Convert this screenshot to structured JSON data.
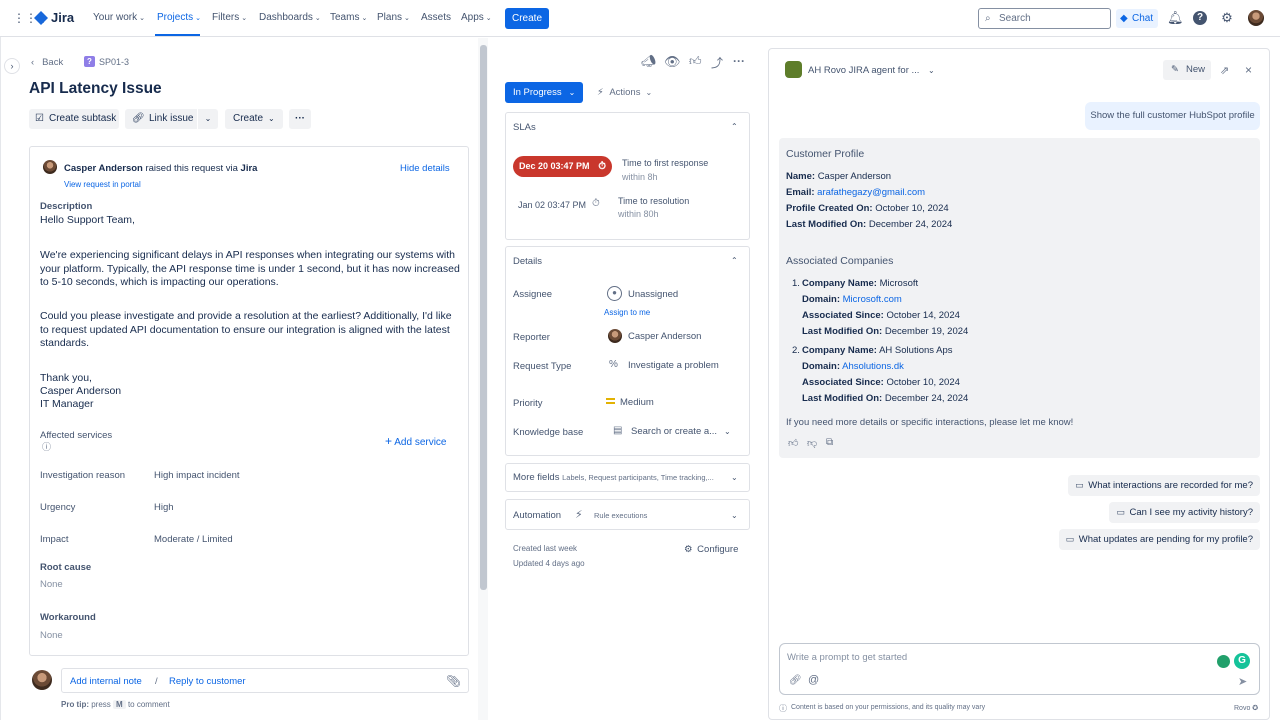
{
  "topnav": {
    "logo": "Jira",
    "items": [
      "Your work",
      "Projects",
      "Filters",
      "Dashboards",
      "Teams",
      "Plans",
      "Assets",
      "Apps"
    ],
    "create": "Create",
    "search_placeholder": "Search",
    "chat": "Chat"
  },
  "issue": {
    "back": "Back",
    "key": "SP01-3",
    "title": "API Latency Issue",
    "actions": {
      "create_subtask": "Create subtask",
      "link_issue": "Link issue",
      "create": "Create"
    },
    "request": {
      "reporter": "Casper Anderson",
      "raised_text": "raised this request via",
      "channel": "Jira",
      "hide_details": "Hide details",
      "view_portal": "View request in portal",
      "description_label": "Description",
      "greeting": "Hello Support Team,",
      "para1": "We're experiencing significant delays in API responses when integrating our systems with your platform. Typically, the API response time is under 1 second, but it has now increased to 5-10 seconds, which is impacting our operations.",
      "para2": "Could you please investigate and provide a resolution at the earliest? Additionally, I'd like to request updated API documentation to ensure our integration is aligned with the latest standards.",
      "sign1": "Thank you,",
      "sign2": "Casper Anderson",
      "sign3": "IT Manager"
    },
    "affected_services": "Affected services",
    "add_service": "Add service",
    "fields": [
      {
        "label": "Investigation reason",
        "value": "High impact incident"
      },
      {
        "label": "Urgency",
        "value": "High"
      },
      {
        "label": "Impact",
        "value": "Moderate / Limited"
      }
    ],
    "root_cause": {
      "label": "Root cause",
      "value": "None"
    },
    "workaround": {
      "label": "Workaround",
      "value": "None"
    },
    "comment": {
      "add_note": "Add internal note",
      "sep": "/",
      "reply": "Reply to customer",
      "protip_label": "Pro tip:",
      "protip_press": "press",
      "protip_key": "M",
      "protip_rest": "to comment"
    }
  },
  "status": {
    "in_progress": "In Progress",
    "actions": "Actions",
    "slas_label": "SLAs",
    "sla1": {
      "date": "Dec 20 03:47 PM",
      "title": "Time to first response",
      "sub": "within 8h"
    },
    "sla2": {
      "date": "Jan 02 03:47 PM",
      "title": "Time to resolution",
      "sub": "within 80h"
    },
    "details_label": "Details",
    "assignee": {
      "label": "Assignee",
      "value": "Unassigned",
      "assign_me": "Assign to me"
    },
    "reporter": {
      "label": "Reporter",
      "value": "Casper Anderson"
    },
    "request_type": {
      "label": "Request Type",
      "value": "Investigate a problem"
    },
    "priority": {
      "label": "Priority",
      "value": "Medium"
    },
    "knowledge": {
      "label": "Knowledge base",
      "value": "Search or create a..."
    },
    "more_fields": {
      "label": "More fields",
      "sub": "Labels, Request participants, Time tracking,..."
    },
    "automation": {
      "label": "Automation",
      "sub": "Rule executions"
    },
    "created": "Created last week",
    "updated": "Updated 4 days ago",
    "configure": "Configure"
  },
  "rovo": {
    "agent": "AH Rovo JIRA agent for ...",
    "new": "New",
    "user_msg": "Show the full customer HubSpot profile",
    "profile_title": "Customer Profile",
    "name_k": "Name:",
    "name_v": "Casper Anderson",
    "email_k": "Email:",
    "email_v": "arafathegazy@gmail.com",
    "created_k": "Profile Created On:",
    "created_v": "October 10, 2024",
    "modified_k": "Last Modified On:",
    "modified_v": "December 24, 2024",
    "companies_title": "Associated Companies",
    "companies": [
      {
        "num": "1.",
        "name_k": "Company Name:",
        "name": "Microsoft",
        "domain_k": "Domain:",
        "domain": "Microsoft.com",
        "since_k": "Associated Since:",
        "since": "October 14, 2024",
        "mod_k": "Last Modified On:",
        "mod": "December 19, 2024"
      },
      {
        "num": "2.",
        "name_k": "Company Name:",
        "name": "AH Solutions Aps",
        "domain_k": "Domain:",
        "domain": "Ahsolutions.dk",
        "since_k": "Associated Since:",
        "since": "October 10, 2024",
        "mod_k": "Last Modified On:",
        "mod": "December 24, 2024"
      }
    ],
    "closing": "If you need more details or specific interactions, please let me know!",
    "suggestions": [
      "What interactions are recorded for me?",
      "Can I see my activity history?",
      "What updates are pending for my profile?"
    ],
    "prompt_placeholder": "Write a prompt to get started",
    "disclaimer": "Content is based on your permissions, and its quality may vary",
    "brand": "Rovo"
  },
  "colors": {
    "brand": "#0c66e4",
    "sla_breach": "#c9372c",
    "priority_medium": "#e2b203"
  }
}
